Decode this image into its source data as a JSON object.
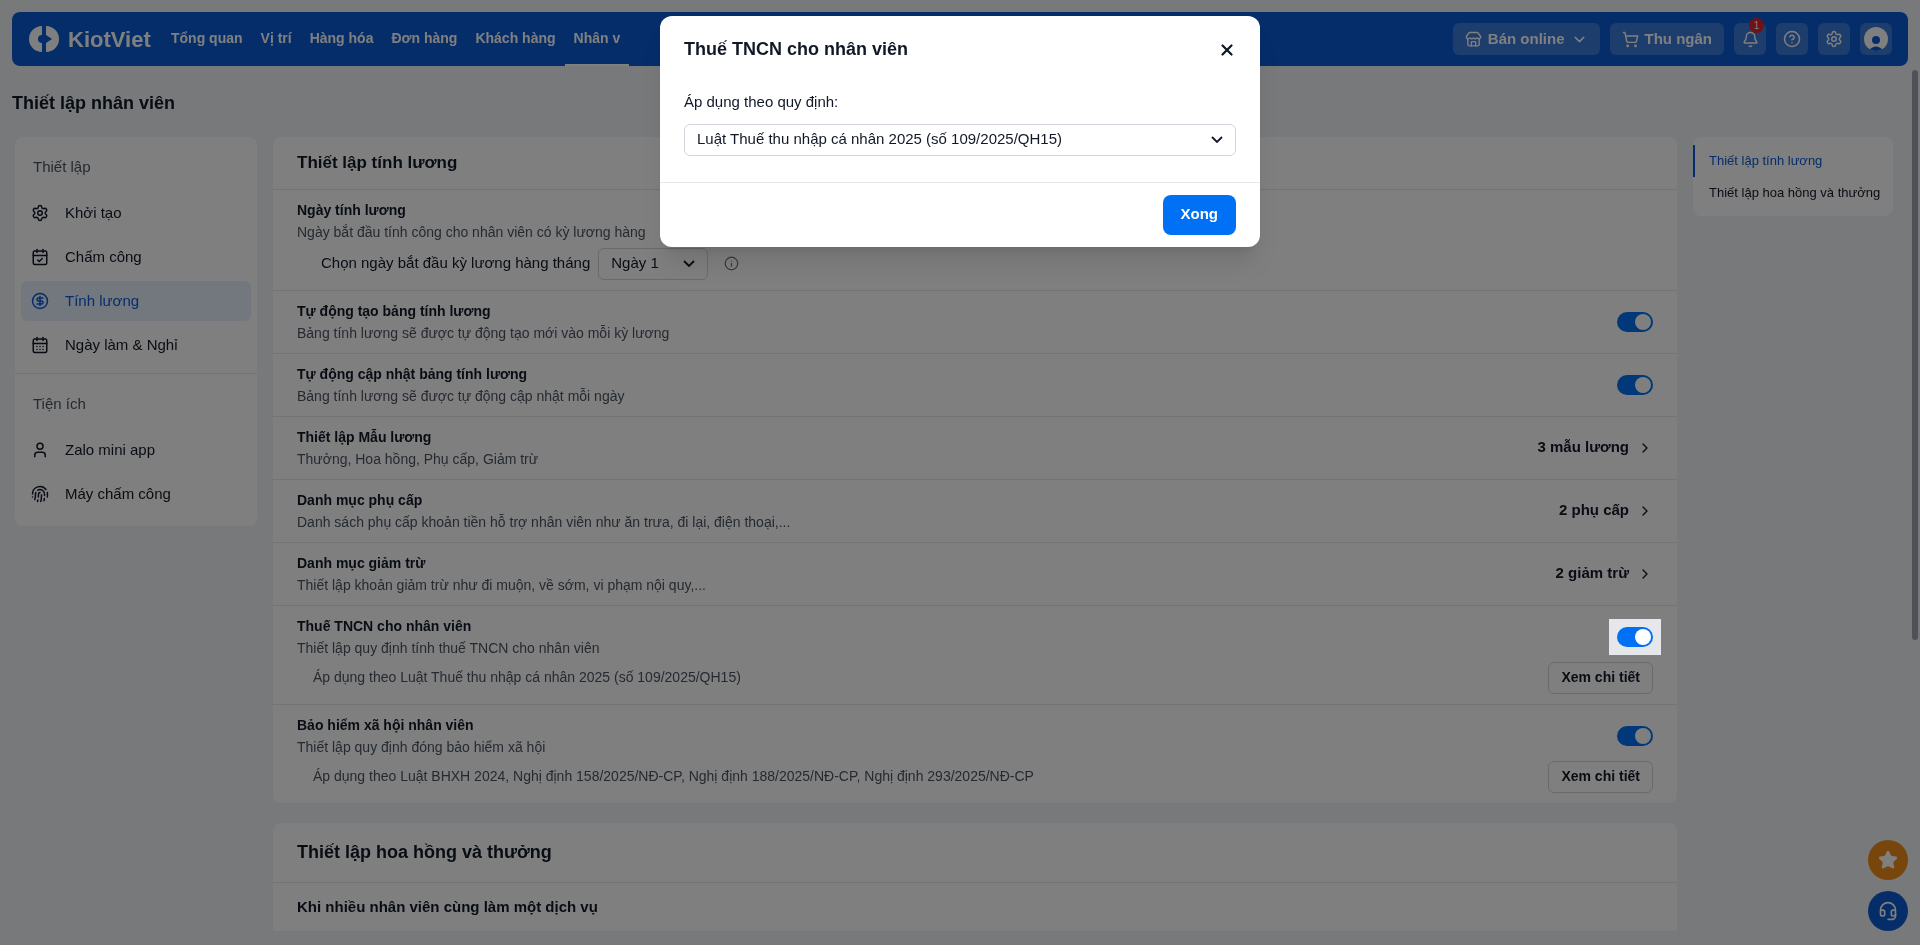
{
  "navbar": {
    "logo": "KiotViet",
    "items": [
      {
        "label": "Tổng quan",
        "selected": false
      },
      {
        "label": "Vị trí",
        "selected": false
      },
      {
        "label": "Hàng hóa",
        "selected": false
      },
      {
        "label": "Đơn hàng",
        "selected": false
      },
      {
        "label": "Khách hàng",
        "selected": false
      },
      {
        "label": "Nhân v",
        "selected": true
      }
    ],
    "actions": [
      {
        "kind": "online",
        "label": "Bán online"
      },
      {
        "kind": "cashier",
        "label": "Thu ngân"
      },
      {
        "kind": "bell",
        "badge": "1"
      },
      {
        "kind": "help"
      },
      {
        "kind": "settings"
      },
      {
        "kind": "avatar"
      }
    ]
  },
  "page_title": "Thiết lập nhân viên",
  "sidebar": {
    "sections": [
      {
        "title": "Thiết lập",
        "items": [
          {
            "label": "Khởi tạo",
            "selected": false
          },
          {
            "label": "Chấm công",
            "selected": false
          },
          {
            "label": "Tính lương",
            "selected": true
          },
          {
            "label": "Ngày làm & Nghỉ",
            "selected": false
          }
        ]
      },
      {
        "title": "Tiện ích",
        "items": [
          {
            "label": "Zalo mini app",
            "selected": false
          },
          {
            "label": "Máy chấm công",
            "selected": false
          }
        ]
      }
    ]
  },
  "payroll": {
    "title": "Thiết lập tính lương",
    "rows": [
      {
        "kind": "date",
        "title": "Ngày tính lương",
        "description": "Ngày bắt đầu tính công cho nhân viên có kỳ lương hàng",
        "field_label": "Chọn ngày bắt đầu kỳ lương hàng tháng",
        "value": "Ngày 1"
      },
      {
        "kind": "toggle",
        "title": "Tự động tạo bảng tính lương",
        "description": "Bảng tính lương sẽ được tự động tạo mới vào mỗi kỳ lương",
        "on": true,
        "focused": false
      },
      {
        "kind": "toggle",
        "title": "Tự động cập nhật bảng tính lương",
        "description": "Bảng tính lương sẽ được tự động cập nhật mỗi ngày",
        "on": true,
        "focused": false
      },
      {
        "kind": "link",
        "title": "Thiết lập Mẫu lương",
        "description": "Thưởng, Hoa hồng, Phụ cấp, Giảm trừ",
        "count": "3 mẫu lương"
      },
      {
        "kind": "link",
        "title": "Danh mục phụ cấp",
        "description": "Danh sách phụ cấp khoản tiền hỗ trợ nhân viên như ăn trưa, đi lại, điện thoại,...",
        "count": "2 phụ cấp"
      },
      {
        "kind": "link",
        "title": "Danh mục giảm trừ",
        "description": "Thiết lập khoản giảm trừ như đi muộn, về sớm, vi phạm nội quy,...",
        "count": "2 giảm trừ"
      },
      {
        "kind": "toggle",
        "title": "Thuế TNCN cho nhân viên",
        "description": "Thiết lập quy định tính thuế TNCN cho nhân viên",
        "on": true,
        "focused": true,
        "note": "Áp dụng theo Luật Thuế thu nhập cá nhân 2025 (số 109/2025/QH15)",
        "button": "Xem chi tiết"
      },
      {
        "kind": "toggle",
        "title": "Bảo hiểm xã hội nhân viên",
        "description": "Thiết lập quy định đóng bảo hiểm xã hội",
        "on": true,
        "focused": false,
        "note": "Áp dụng theo Luật BHXH 2024, Nghị định 158/2025/NĐ-CP, Nghị định 188/2025/NĐ-CP, Nghị định 293/2025/NĐ-CP",
        "button": "Xem chi tiết"
      }
    ]
  },
  "commission": {
    "title": "Thiết lập hoa hồng và thưởng",
    "first_row": "Khi nhiều nhân viên cùng làm một dịch vụ"
  },
  "toc": [
    {
      "label": "Thiết lập tính lương",
      "selected": true
    },
    {
      "label": "Thiết lập hoa hồng và thưởng",
      "selected": false
    }
  ],
  "dialog": {
    "title": "Thuế TNCN cho nhân viên",
    "field_label": "Áp dụng theo quy định:",
    "value": "Luật Thuế thu nhập cá nhân 2025 (số 109/2025/QH15)",
    "button": "Xong"
  }
}
